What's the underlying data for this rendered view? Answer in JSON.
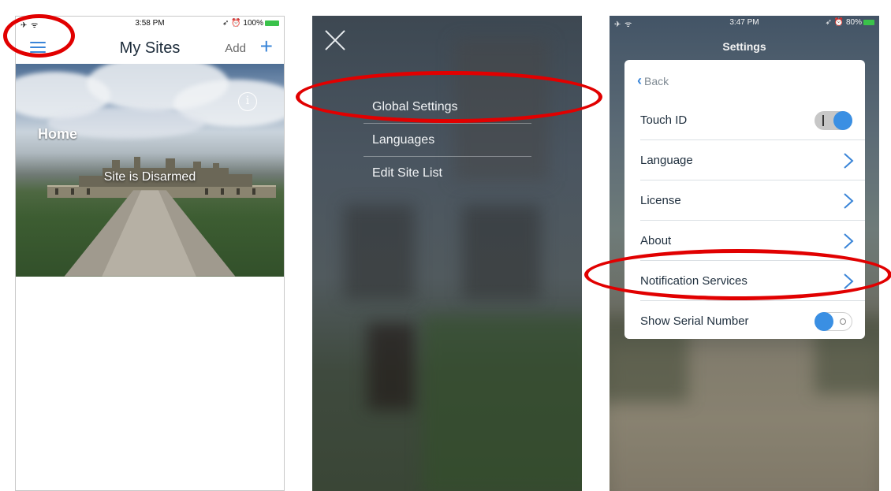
{
  "screen1": {
    "status": {
      "left": "✈ ᯤ",
      "time": "3:58 PM",
      "right": "➶ ⏰ 100%"
    },
    "title": "My Sites",
    "add_label": "Add",
    "plus_label": "+",
    "site_name": "Home",
    "site_status": "Site is Disarmed",
    "info_label": "i"
  },
  "screen2": {
    "menu": [
      {
        "label": "Global Settings"
      },
      {
        "label": "Languages"
      },
      {
        "label": "Edit Site List"
      }
    ]
  },
  "screen3": {
    "status": {
      "left": "✈ ᯤ",
      "time": "3:47 PM",
      "right": "➶ ⏰ 80%"
    },
    "title": "Settings",
    "back_label": "Back",
    "rows": [
      {
        "label": "Touch ID",
        "control": "toggle",
        "state": "on"
      },
      {
        "label": "Language",
        "control": "chevron"
      },
      {
        "label": "License",
        "control": "chevron"
      },
      {
        "label": "About",
        "control": "chevron"
      },
      {
        "label": "Notification Services",
        "control": "chevron"
      },
      {
        "label": "Show Serial Number",
        "control": "toggle",
        "state": "off"
      }
    ]
  },
  "colors": {
    "accent": "#3a85d8",
    "annotation": "#e10000"
  },
  "icons": [
    "hamburger-menu-icon",
    "plus-icon",
    "info-icon",
    "close-icon",
    "chevron-left-icon",
    "chevron-right-icon"
  ]
}
